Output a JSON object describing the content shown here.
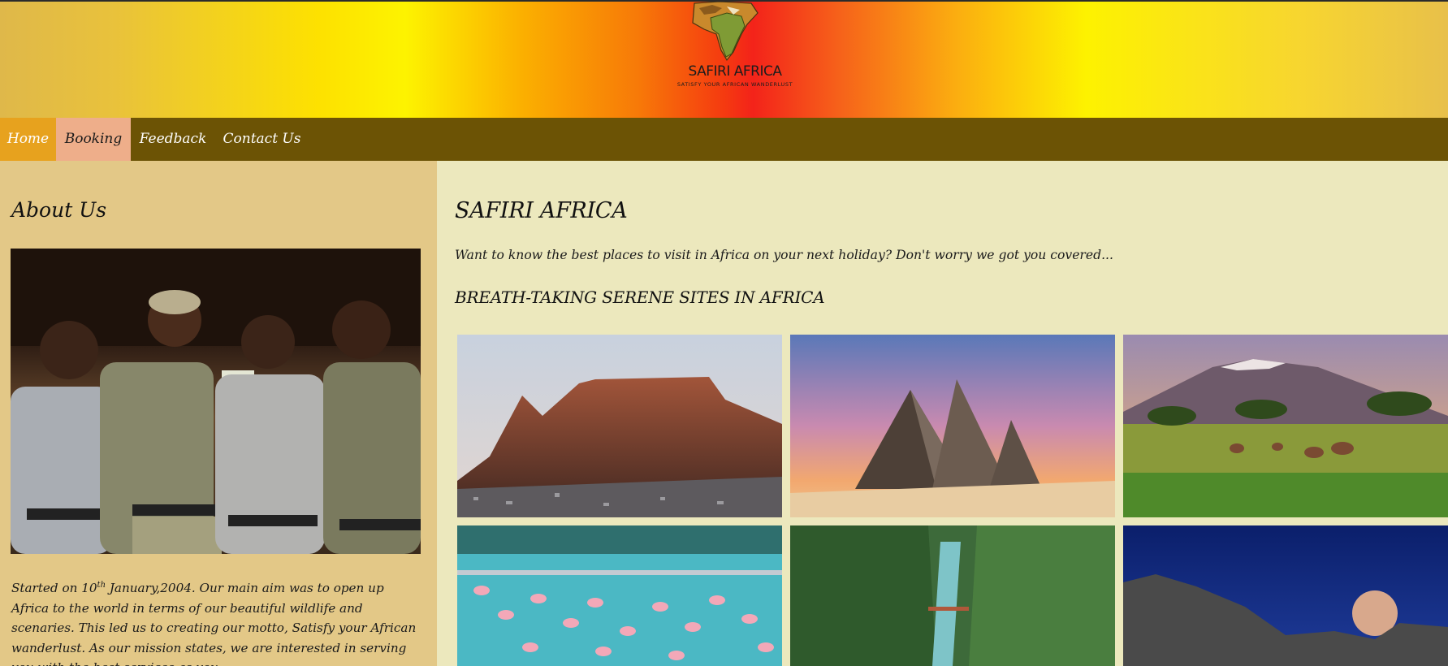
{
  "header": {
    "brand_name": "SAFIRI AFRICA",
    "brand_motto": "Satisfy your African wanderlust"
  },
  "nav": {
    "items": [
      {
        "label": "Home"
      },
      {
        "label": "Booking"
      },
      {
        "label": "Feedback"
      },
      {
        "label": "Contact Us"
      }
    ]
  },
  "sidebar": {
    "heading": "About Us",
    "photo_alt": "Safari guides team photo",
    "text_before_sup": "Started on 10",
    "text_sup": "th",
    "text_after_sup": " January,2004. Our main aim was to open up Africa to the world in terms of our beautiful wildlife and scenaries. This led us to creating our motto, Satisfy your African wanderlust. As our mission states, we are interested in serving you with the best services as you"
  },
  "main": {
    "title": "SAFIRI AFRICA",
    "intro": "Want to know the best places to visit in Africa on your next holiday? Don't worry we got you covered...",
    "subtitle": "BREATH-TAKING SERENE SITES IN AFRICA",
    "gallery": [
      {
        "name": "table-mountain-photo"
      },
      {
        "name": "pyramids-photo"
      },
      {
        "name": "kilimanjaro-savanna-photo"
      },
      {
        "name": "flamingos-lake-photo"
      },
      {
        "name": "forest-river-photo"
      },
      {
        "name": "moonrise-mountain-photo"
      }
    ]
  },
  "colors": {
    "nav_bg": "#6c5305",
    "nav_home_active": "#e7a21e",
    "nav_booking_hover": "#eeae8a",
    "sidebar_bg": "#e3c887",
    "main_bg": "#ece8bd"
  }
}
